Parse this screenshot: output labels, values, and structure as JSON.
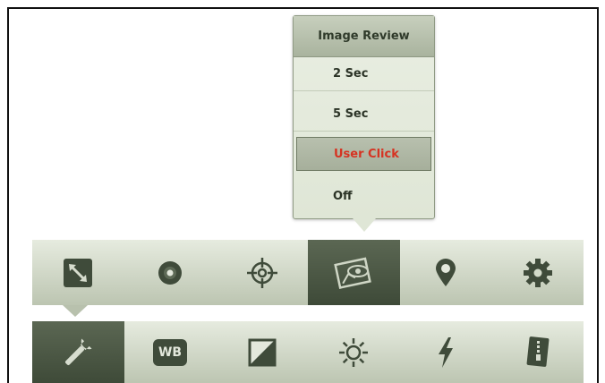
{
  "popup": {
    "title": "Image Review",
    "options": [
      "2 Sec",
      "5 Sec",
      "User Click",
      "Off"
    ],
    "selected": "User Click",
    "selected_color": "#d63322"
  },
  "toolbar_top": {
    "items": [
      "resize-icon",
      "disc-icon",
      "crosshair-icon",
      "image-review-icon",
      "location-pin-icon",
      "gear-icon"
    ],
    "active": "image-review-icon"
  },
  "toolbar_bottom": {
    "wb_label": "WB",
    "items": [
      "wrench-icon",
      "white-balance-icon",
      "contrast-icon",
      "brightness-icon",
      "flash-icon",
      "archive-icon"
    ],
    "active": "wrench-icon"
  },
  "colors": {
    "bar_light": "#e6ebdf",
    "bar_dark": "#bcc5b1",
    "active": "#4a5644",
    "icon": "#3f4b3a"
  }
}
